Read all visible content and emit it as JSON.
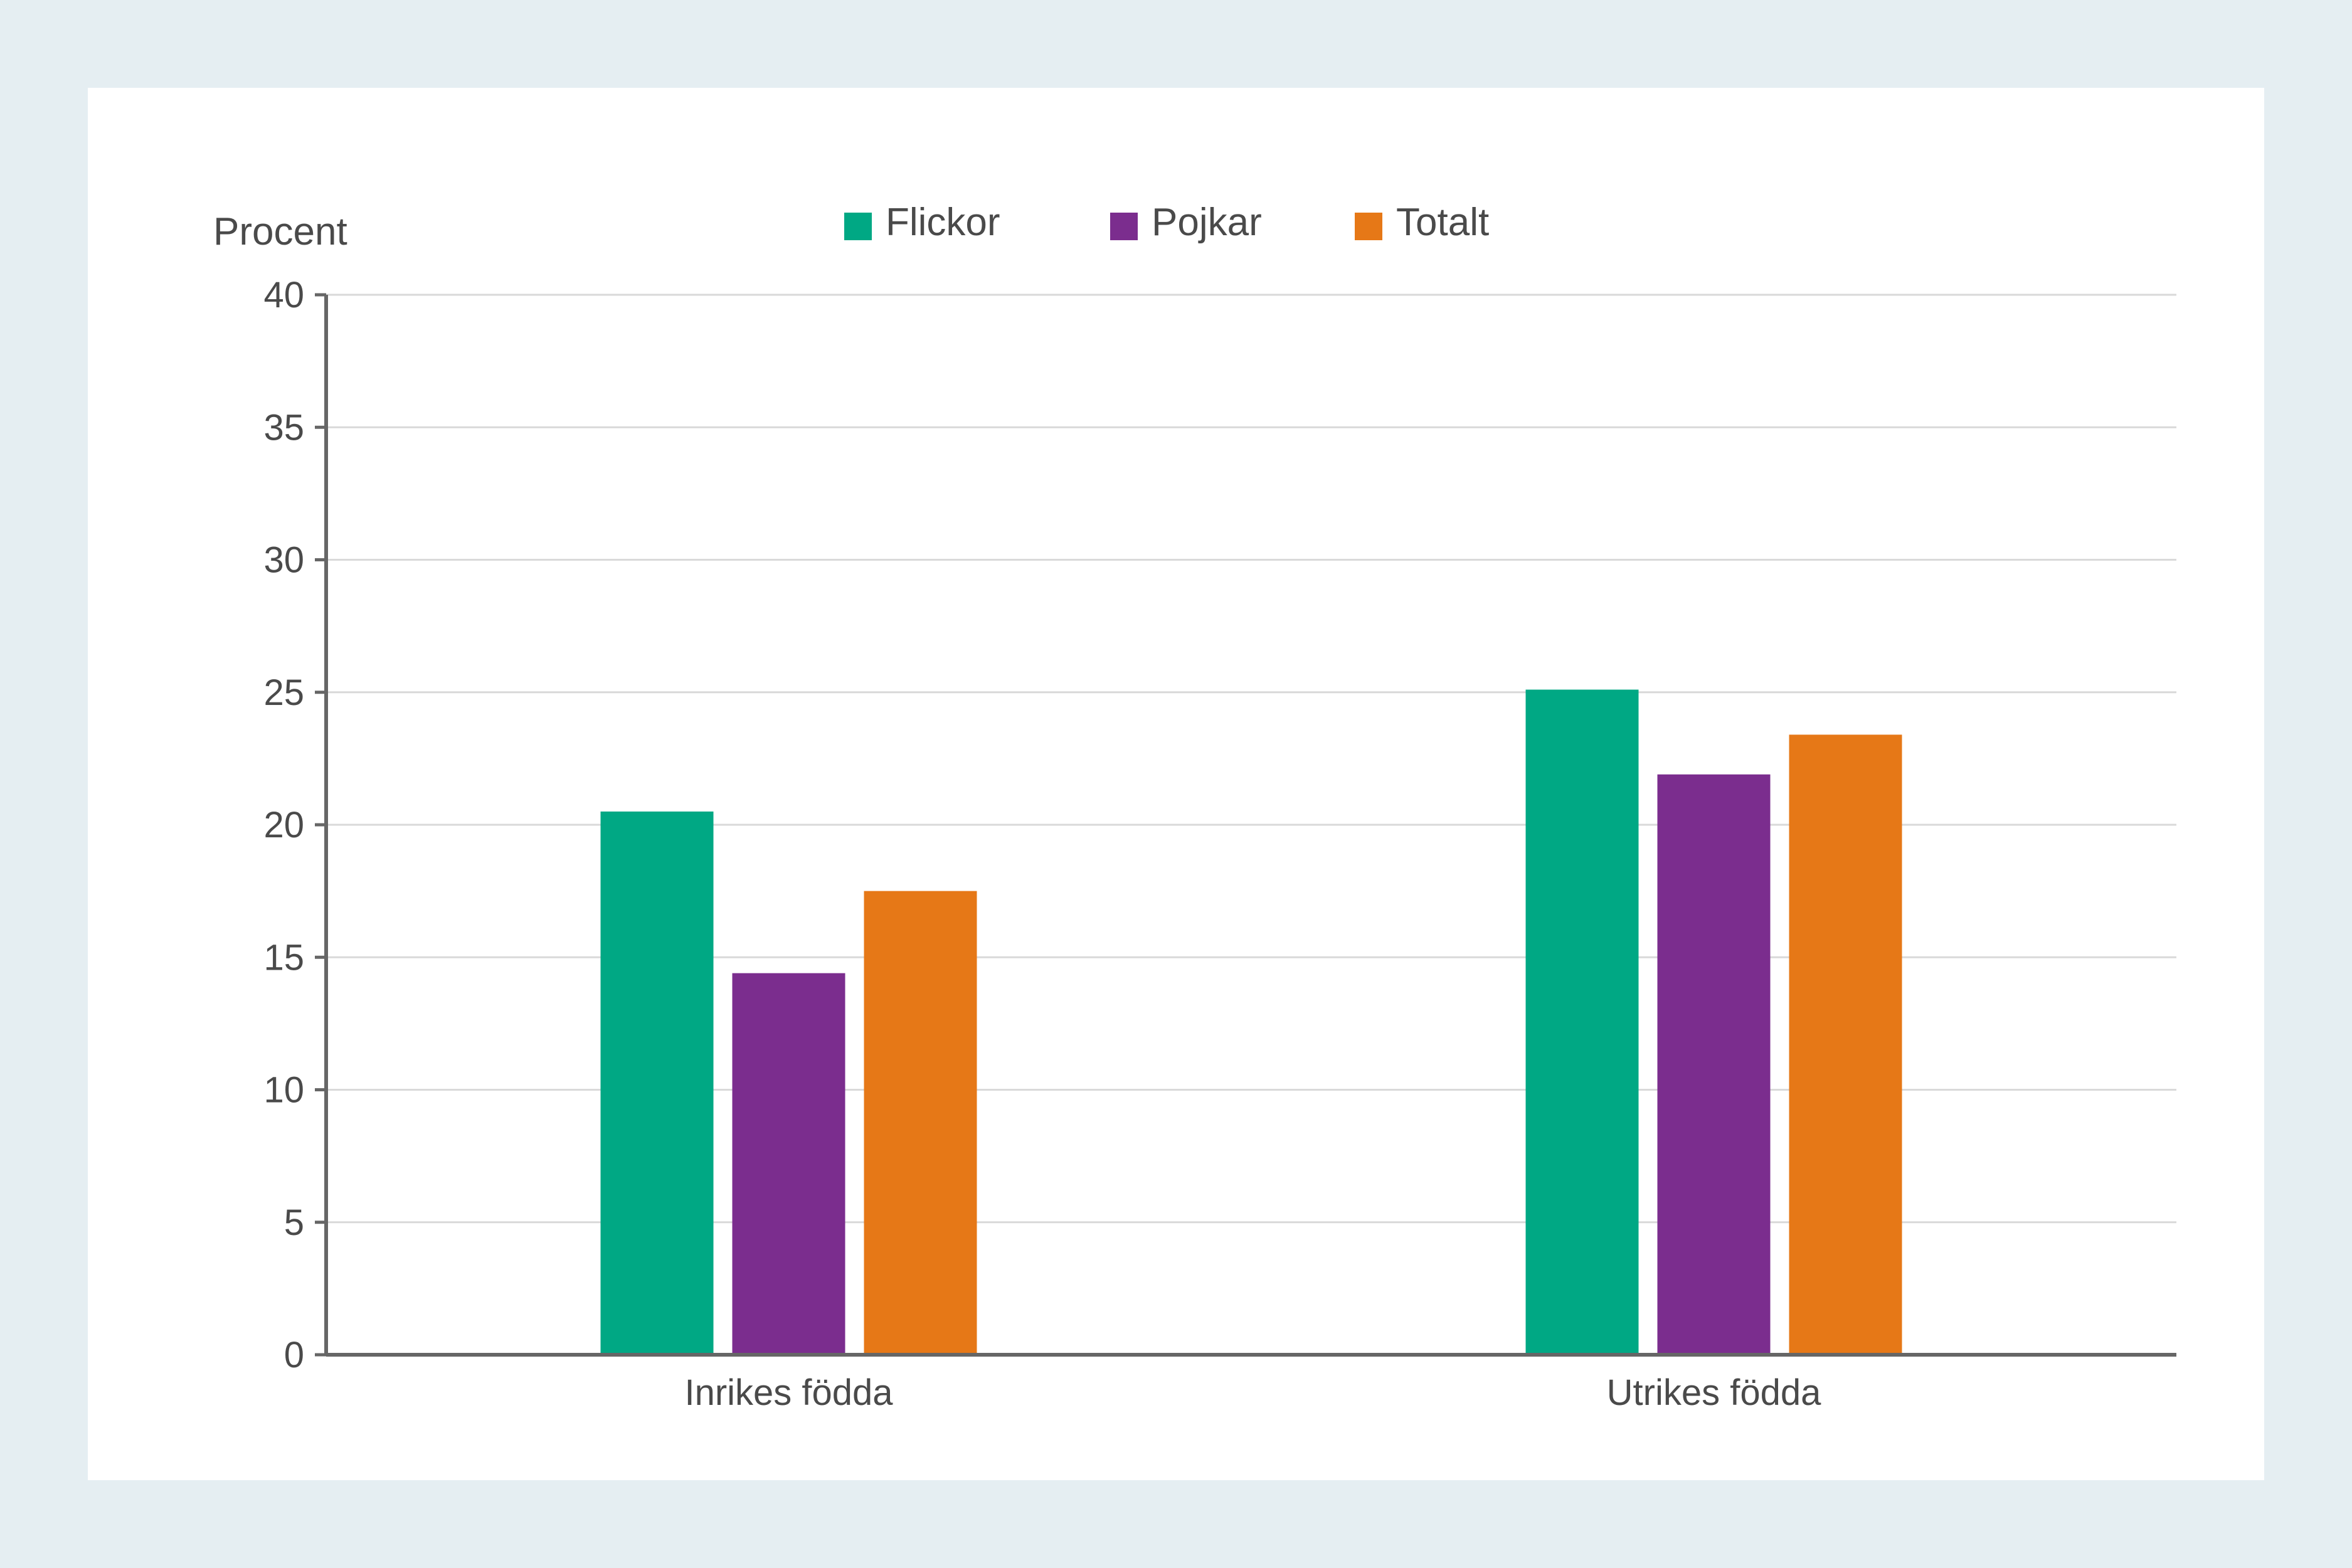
{
  "chart_data": {
    "type": "bar",
    "ylabel": "Procent",
    "xlabel": "",
    "title": "",
    "categories": [
      "Inrikes födda",
      "Utrikes födda"
    ],
    "series": [
      {
        "name": "Flickor",
        "color": "#00a884",
        "values": [
          20.5,
          25.1
        ]
      },
      {
        "name": "Pojkar",
        "color": "#7b2d8e",
        "values": [
          14.4,
          21.9
        ]
      },
      {
        "name": "Totalt",
        "color": "#e67817",
        "values": [
          17.5,
          23.4
        ]
      }
    ],
    "ylim": [
      0,
      40
    ],
    "yticks": [
      0,
      5,
      10,
      15,
      20,
      25,
      30,
      35,
      40
    ],
    "grid": true,
    "legend_position": "top"
  }
}
